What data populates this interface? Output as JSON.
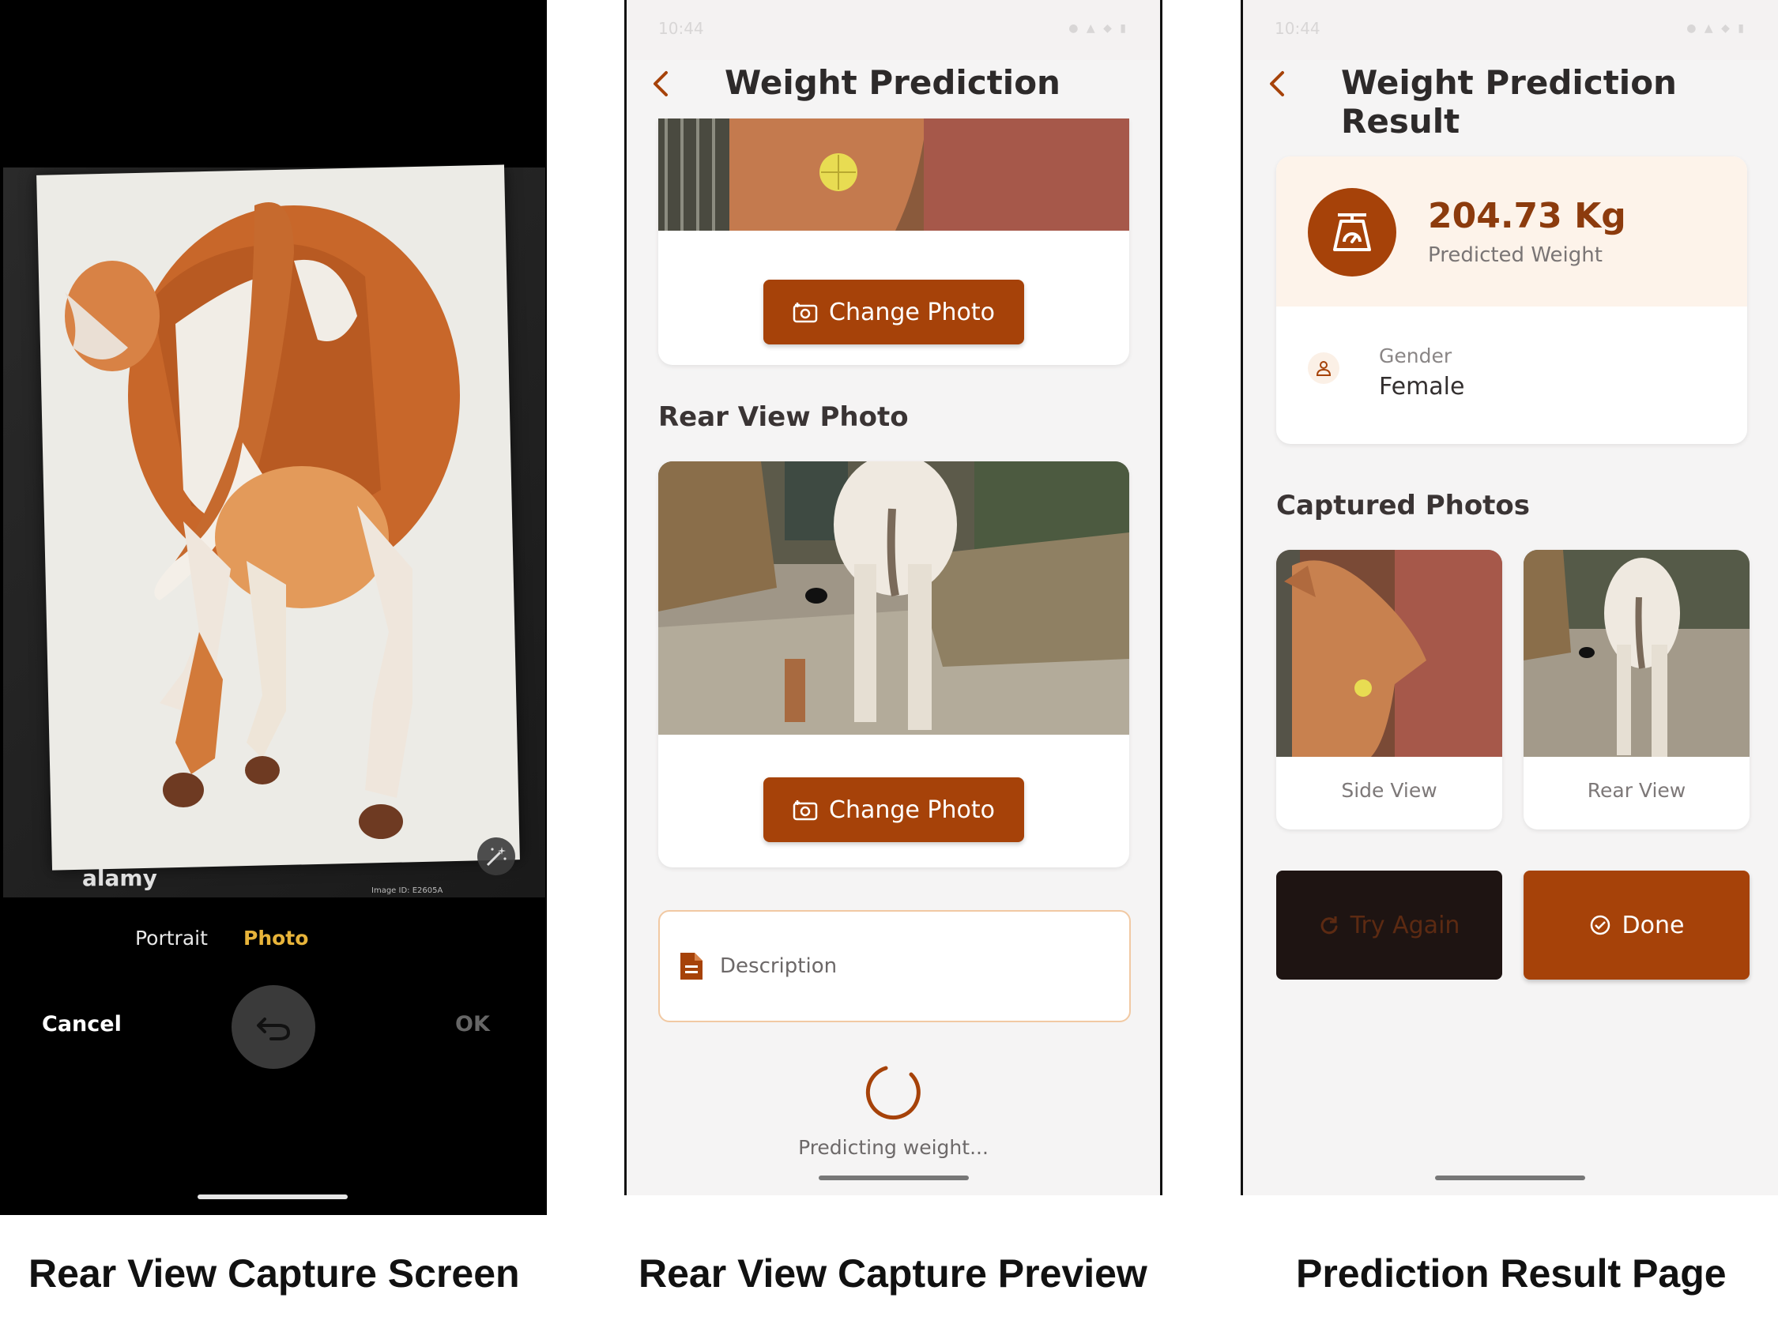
{
  "colors": {
    "accent": "#a64209",
    "accent_dark": "#8c3b0d",
    "camera_active": "#e8b43a",
    "try_again_bg": "#1e1412"
  },
  "camera": {
    "watermark": "alamy",
    "image_id": "Image ID: E2605A",
    "modes": [
      "Portrait",
      "Photo"
    ],
    "active_mode": "Photo",
    "cancel_label": "Cancel",
    "ok_label": "OK",
    "icons": {
      "shutter": "undo-icon",
      "magic": "magic-wand-icon"
    }
  },
  "preview": {
    "status_time": "10:44",
    "title": "Weight Prediction",
    "change_photo_label": "Change Photo",
    "rear_section_title": "Rear View Photo",
    "description_placeholder": "Description",
    "loading_text": "Predicting weight..."
  },
  "result": {
    "status_time": "10:44",
    "title": "Weight Prediction Result",
    "weight_value": "204.73 Kg",
    "weight_label": "Predicted Weight",
    "gender_label": "Gender",
    "gender_value": "Female",
    "photos_title": "Captured Photos",
    "photos": [
      {
        "caption": "Side View"
      },
      {
        "caption": "Rear View"
      }
    ],
    "try_again_label": "Try Again",
    "done_label": "Done"
  },
  "captions": [
    "Rear View Capture Screen",
    "Rear View Capture Preview",
    "Prediction Result Page"
  ]
}
